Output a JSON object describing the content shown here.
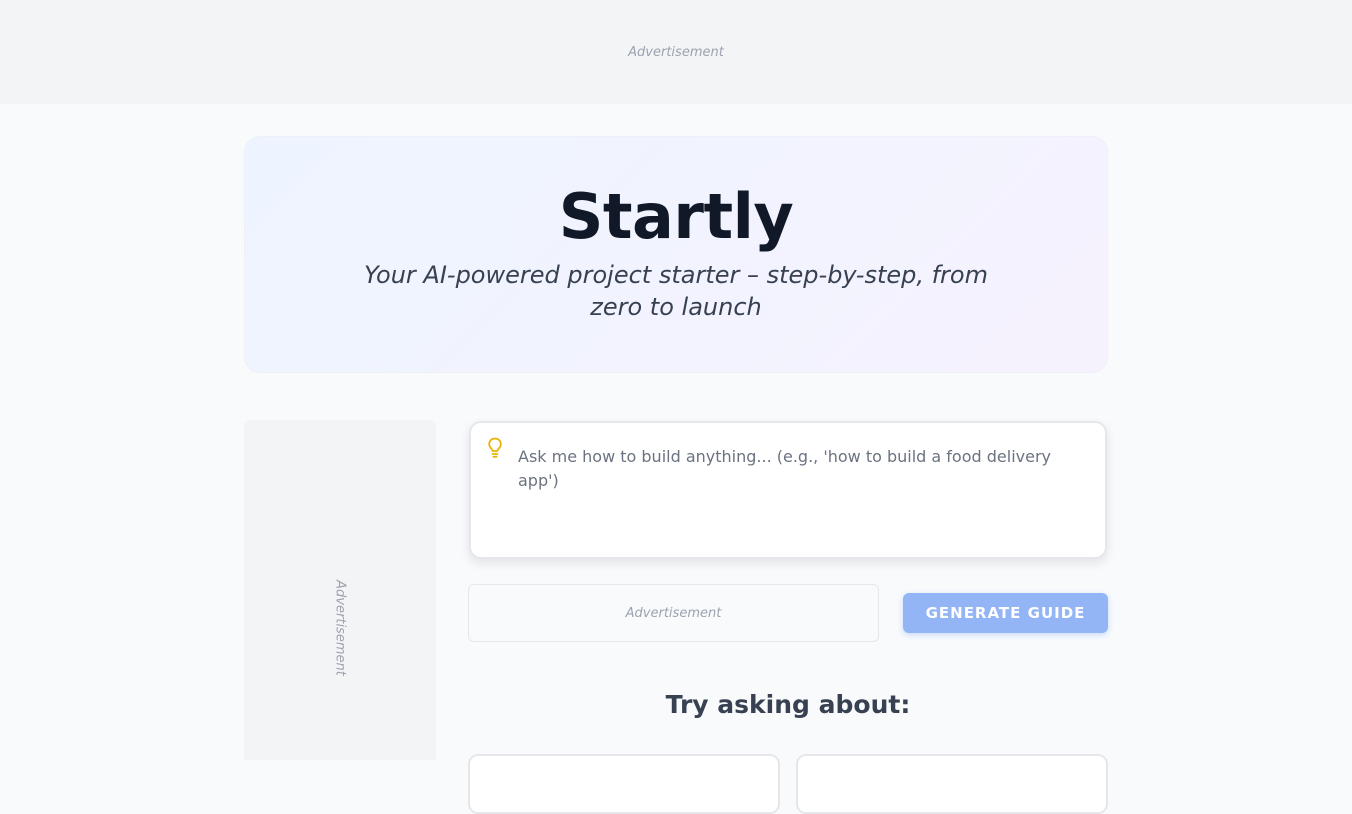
{
  "top_ad": {
    "label": "Advertisement"
  },
  "hero": {
    "title": "Startly",
    "subtitle": "Your AI-powered project starter – step-by-step, from zero to launch"
  },
  "side_ad": {
    "label": "Advertisement"
  },
  "prompt": {
    "icon": "lightbulb-icon",
    "placeholder": "Ask me how to build anything... (e.g., 'how to build a food delivery app')",
    "value": ""
  },
  "inline_ad": {
    "label": "Advertisement"
  },
  "generate_button": {
    "label": "GENERATE GUIDE"
  },
  "suggestions": {
    "heading": "Try asking about:"
  },
  "colors": {
    "accent": "#93b4f5",
    "icon": "#eab308",
    "title": "#111827",
    "background": "#f8fafc"
  }
}
